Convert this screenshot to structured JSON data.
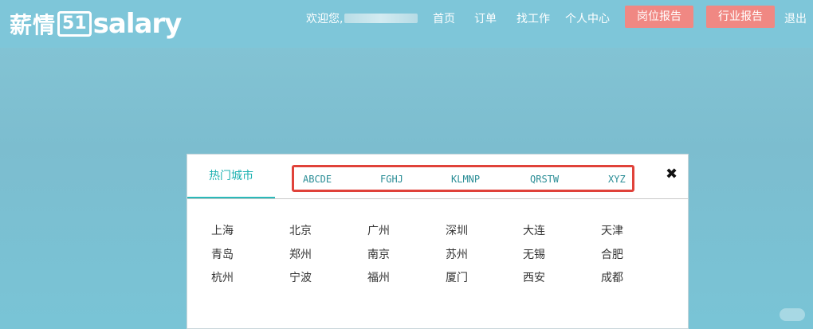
{
  "header": {
    "logo_cn": "薪情",
    "logo_num": "51",
    "logo_en": "salary",
    "welcome": "欢迎您,",
    "nav": [
      "首页",
      "订单",
      "找工作",
      "个人中心"
    ],
    "btn_position_report": "岗位报告",
    "btn_industry_report": "行业报告",
    "logout": "退出"
  },
  "city_panel": {
    "hot_tab": "热门城市",
    "letter_tabs": [
      "ABCDE",
      "FGHJ",
      "KLMNP",
      "QRSTW",
      "XYZ"
    ],
    "close_glyph": "✖",
    "cities": [
      [
        "上海",
        "北京",
        "广州",
        "深圳",
        "大连",
        "天津"
      ],
      [
        "青岛",
        "郑州",
        "南京",
        "苏州",
        "无锡",
        "合肥"
      ],
      [
        "杭州",
        "宁波",
        "福州",
        "厦门",
        "西安",
        "成都"
      ]
    ]
  },
  "colors": {
    "accent": "#1fb2b2",
    "report_button": "#f08883",
    "highlight_box": "#e0423a"
  }
}
